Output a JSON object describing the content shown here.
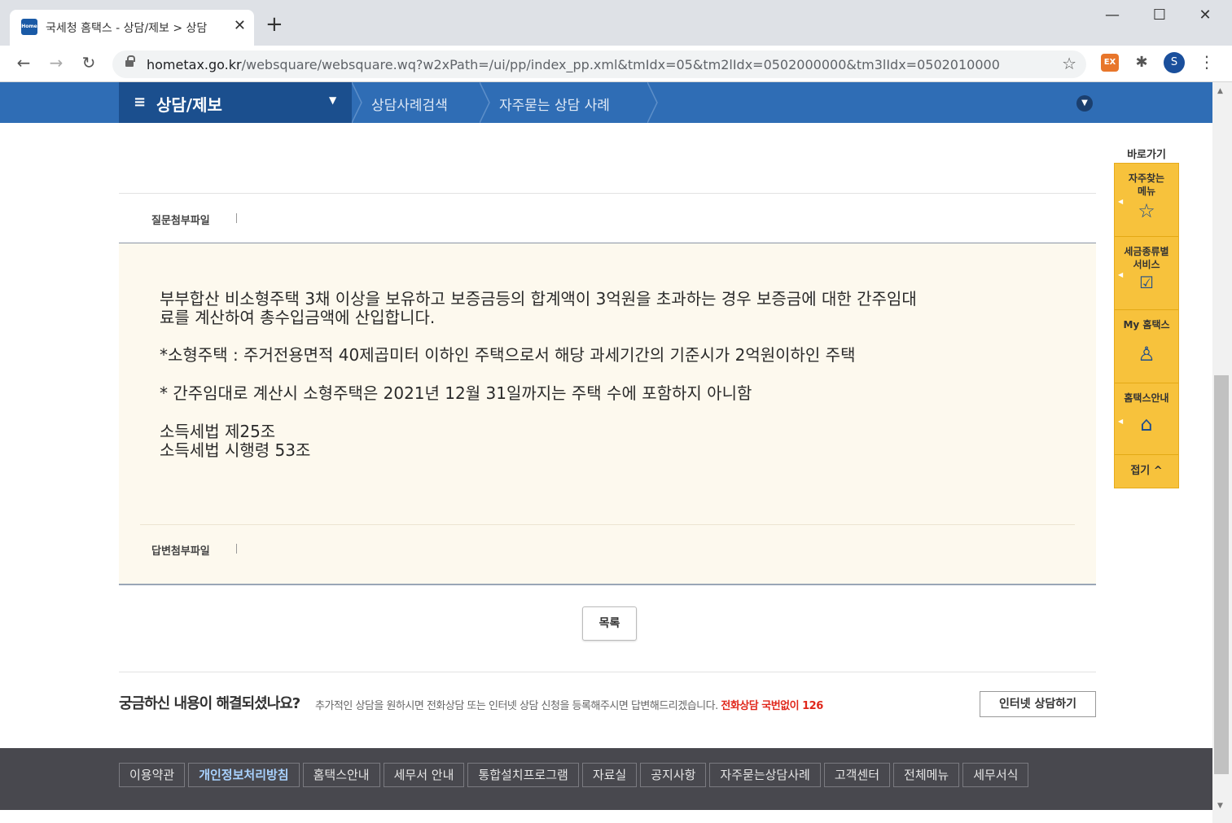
{
  "browser": {
    "tab_title": "국세청 홈택스 - 상담/제보 > 상담",
    "favicon_text": "Home",
    "url_host": "hometax.go.kr",
    "url_path": "/websquare/websquare.wq?w2xPath=/ui/pp/index_pp.xml&tmIdx=05&tm2lIdx=0502000000&tm3lIdx=0502010000",
    "profile_initial": "S",
    "ext_label": "EX"
  },
  "gnb": {
    "title": "상담/제보",
    "crumbs": [
      "상담사례검색",
      "자주묻는 상담 사례"
    ]
  },
  "question": {
    "attach_label": "질문첨부파일"
  },
  "answer": {
    "lines": [
      "부부합산 비소형주택 3채 이상을 보유하고 보증금등의 합계액이 3억원을 초과하는 경우 보증금에 대한 간주임대",
      "료를 계산하여 총수입금액에 산입합니다.",
      "*소형주택 : 주거전용면적 40제곱미터 이하인 주택으로서 해당 과세기간의 기준시가 2억원이하인 주택",
      "* 간주임대로 계산시 소형주택은 2021년 12월 31일까지는 주택 수에 포함하지 아니함",
      "소득세법 제25조",
      "소득세법 시행령 53조"
    ],
    "attach_label": "답변첨부파일"
  },
  "list_button": "목록",
  "help": {
    "question": "궁금하신 내용이 해결되셨나요?",
    "desc": "추가적인 상담을 원하시면 전화상담 또는 인터넷 상담 신청을 등록해주시면 답변해드리겠습니다.",
    "phone": "전화상담 국번없이 126",
    "internet_button": "인터넷 상담하기"
  },
  "footer": {
    "links": [
      "이용약관",
      "개인정보처리방침",
      "홈택스안내",
      "세무서 안내",
      "통합설치프로그램",
      "자료실",
      "공지사항",
      "자주묻는상담사례",
      "고객센터",
      "전체메뉴",
      "세무서식"
    ]
  },
  "quick_menu": {
    "title": "바로가기",
    "items": [
      {
        "label_1": "자주찾는",
        "label_2": "메뉴",
        "icon": "star-icon"
      },
      {
        "label_1": "세금종류별",
        "label_2": "서비스",
        "icon": "checkbox-icon"
      },
      {
        "label_1": "My 홈택스",
        "label_2": "",
        "icon": "user-icon"
      },
      {
        "label_1": "홈택스안내",
        "label_2": "",
        "icon": "house-icon"
      }
    ],
    "fold": "접기 ^"
  },
  "colors": {
    "gnb": "#2f6db5",
    "gnb_dark": "#1b4f8e",
    "quick_menu": "#f7c23c",
    "answer_bg": "#fdf9ee",
    "phone_red": "#e0271b"
  }
}
